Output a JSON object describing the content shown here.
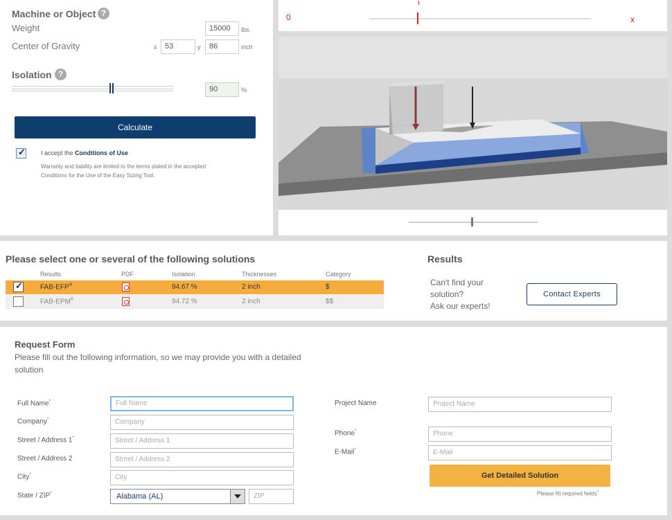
{
  "machine": {
    "title": "Machine or Object",
    "weight_label": "Weight",
    "weight_value": "15000",
    "weight_unit": "lbs.",
    "cog_label": "Center of Gravity",
    "x_label": "x",
    "x_value": "53",
    "y_label": "y",
    "y_value": "86",
    "cog_unit": "inch"
  },
  "isolation": {
    "title": "Isolation",
    "value": "90",
    "unit": "%",
    "level": 0.55
  },
  "calculate_label": "Calculate",
  "conditions": {
    "prefix": "I accept the ",
    "link": "Conditions of Use",
    "note_line1": "Warranty and liability are limited to the terms stated in the accepted",
    "note_line2": "Conditions for the Use of the Easy Sizing Tool."
  },
  "slider_top": {
    "min_label": "0",
    "max_label": "x"
  },
  "solutions": {
    "title": "Please select one or several of the following solutions",
    "headers": [
      "Results",
      "PDF",
      "Isolation",
      "Thicknesses",
      "Category"
    ],
    "rows": [
      {
        "name": "FAB-EFP",
        "mark": "®",
        "isolation": "94.67 %",
        "thickness": "2 inch",
        "category": "$",
        "checked": true
      },
      {
        "name": "FAB-EPM",
        "mark": "®",
        "isolation": "94.72 %",
        "thickness": "2 inch",
        "category": "$$",
        "checked": false
      }
    ]
  },
  "results": {
    "title": "Results",
    "line1": "Can't find your",
    "line2": "solution?",
    "line3": "Ask our experts!",
    "contact_label": "Contact Experts"
  },
  "request_form": {
    "title": "Request Form",
    "subtitle_line1": "Please fill out the following information, so we may provide you with a detailed",
    "subtitle_line2": "solution",
    "full_name_label": "Full Name",
    "full_name_placeholder": "Full Name",
    "company_label": "Company",
    "company_placeholder": "Company",
    "street1_label": "Street / Address 1",
    "street1_placeholder": "Street / Address 1",
    "street2_label": "Street / Address 2",
    "street2_placeholder": "Street / Address 2",
    "city_label": "City",
    "city_placeholder": "City",
    "state_label": "State / ZIP",
    "state_value": "Alabama (AL)",
    "zip_placeholder": "ZIP",
    "project_label": "Project Name",
    "project_placeholder": "Project Name",
    "phone_label": "Phone",
    "phone_placeholder": "Phone",
    "email_label": "E-Mail",
    "email_placeholder": "E-Mail",
    "submit_label": "Get Detailed Solution",
    "required_note": "Please fill required fields",
    "required_mark": "*"
  }
}
